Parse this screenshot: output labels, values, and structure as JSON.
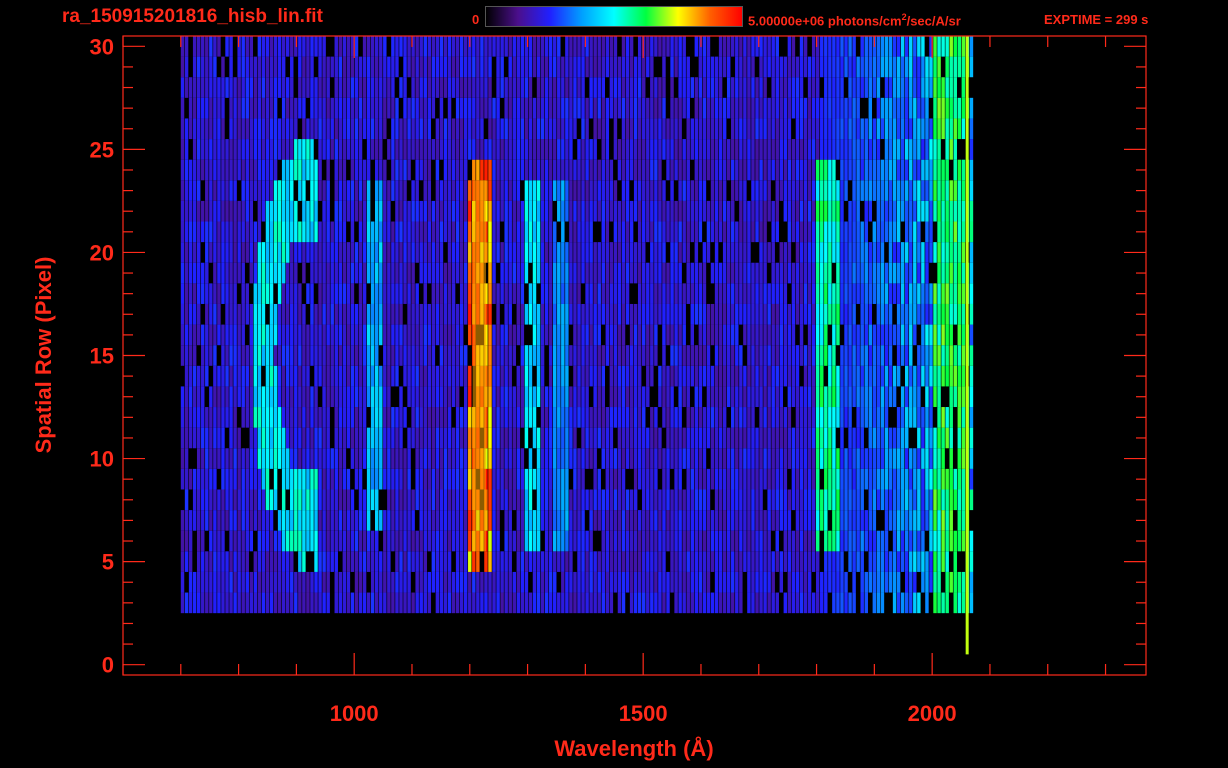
{
  "header": {
    "file_name": "ra_150915201816_hisb_lin.fit",
    "colorbar_min": "0",
    "colorbar_max_value": "5.00000e+06 photons/cm",
    "colorbar_max_exp": "2",
    "colorbar_max_units": "/sec/A/sr",
    "exptime": "EXPTIME = 299 s"
  },
  "colors": {
    "axis": "#ff2a1a",
    "background": "#000000",
    "colormap": [
      "#000000",
      "#4b0f8c",
      "#2020ff",
      "#00a0ff",
      "#00ffff",
      "#00ff40",
      "#ffff00",
      "#ff6000",
      "#ff0000"
    ]
  },
  "chart_data": {
    "type": "heatmap",
    "title": "ra_150915201816_hisb_lin.fit",
    "xlabel": "Wavelength (Å)",
    "ylabel": "Spatial Row (Pixel)",
    "xlim": [
      600,
      2370
    ],
    "ylim": [
      -0.5,
      30.5
    ],
    "xticks": [
      1000,
      1500,
      2000
    ],
    "yticks": [
      0,
      5,
      10,
      15,
      20,
      25,
      30
    ],
    "x_minor_step": 100,
    "y_minor_step": 1,
    "colorbar_range": [
      0,
      5000000
    ],
    "colorbar_units": "photons/cm^2/sec/A/sr",
    "exposure_time_s": 299,
    "data_extent_x": [
      700,
      2070
    ],
    "data_extent_y": [
      3,
      30
    ],
    "features": [
      {
        "name": "arc",
        "x_center": 915,
        "x_radius": 75,
        "y_center": 15,
        "y_radius": 8,
        "intensity": 0.5
      },
      {
        "name": "band",
        "x_center": 1030,
        "width": 30,
        "y_range": [
          7,
          23
        ],
        "intensity": 0.4
      },
      {
        "name": "band",
        "x_center": 1216,
        "width": 40,
        "y_range": [
          5,
          24
        ],
        "intensity": 0.85
      },
      {
        "name": "band",
        "x_center": 1304,
        "width": 30,
        "y_range": [
          6,
          23
        ],
        "intensity": 0.45
      },
      {
        "name": "band",
        "x_center": 1356,
        "width": 30,
        "y_range": [
          6,
          23
        ],
        "intensity": 0.35
      },
      {
        "name": "band",
        "x_center": 1815,
        "width": 40,
        "y_range": [
          6,
          24
        ],
        "intensity": 0.55
      },
      {
        "name": "band",
        "x_center": 2030,
        "width": 60,
        "y_range": [
          2,
          30
        ],
        "intensity": 0.6
      }
    ]
  }
}
